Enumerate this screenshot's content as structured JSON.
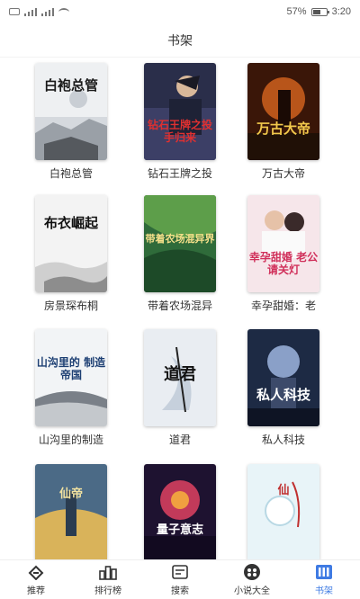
{
  "status_bar": {
    "battery_percent": "57%",
    "time": "3:20",
    "battery_level": 0.57
  },
  "header": {
    "title": "书架"
  },
  "books": [
    {
      "title": "白袍总管",
      "cover_text": "白袍总管"
    },
    {
      "title": "钻石王牌之投",
      "cover_text": "钻石王牌之投手归来"
    },
    {
      "title": "万古大帝",
      "cover_text": "万古大帝"
    },
    {
      "title": "房景琛布桐",
      "cover_text": "布衣崛起"
    },
    {
      "title": "带着农场混异",
      "cover_text": "带着农场混异界"
    },
    {
      "title": "幸孕甜婚：老",
      "cover_text": "幸孕甜婚 老公 请关灯"
    },
    {
      "title": "山沟里的制造",
      "cover_text": "山沟里的 制造帝国"
    },
    {
      "title": "道君",
      "cover_text": "道君"
    },
    {
      "title": "私人科技",
      "cover_text": "私人科技"
    },
    {
      "title": "",
      "cover_text": "仙帝"
    },
    {
      "title": "",
      "cover_text": "量子意志"
    },
    {
      "title": "",
      "cover_text": "仙"
    }
  ],
  "tabs": [
    {
      "label": "推荐",
      "icon": "recommend-icon"
    },
    {
      "label": "排行榜",
      "icon": "ranking-icon"
    },
    {
      "label": "搜索",
      "icon": "search-icon"
    },
    {
      "label": "小说大全",
      "icon": "library-icon"
    },
    {
      "label": "书架",
      "icon": "bookshelf-icon",
      "active": true
    }
  ],
  "colors": {
    "accent": "#3f7be3",
    "text": "#333333",
    "background": "#ffffff"
  }
}
